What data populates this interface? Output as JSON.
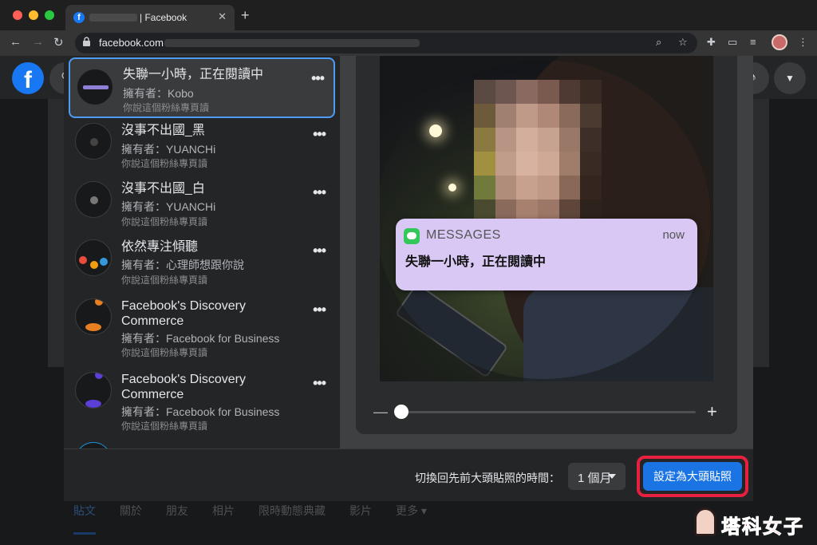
{
  "browser": {
    "tab_title": "| Facebook",
    "url": "facebook.com",
    "tab_close": "✕",
    "new_tab": "+"
  },
  "facebook": {
    "bottom_tabs": [
      "貼文",
      "關於",
      "朋友",
      "相片",
      "限時動態典藏",
      "影片",
      "更多 ▾"
    ]
  },
  "sidebar": {
    "items": [
      {
        "name": "失聯一小時，正在閱讀中",
        "owner": "擁有者：Kobo",
        "subtitle": "你說這個粉絲專頁讀",
        "selected": true
      },
      {
        "name": "沒事不出國_黑",
        "owner": "擁有者：YUANCHi",
        "subtitle": "你說這個粉絲專頁讀"
      },
      {
        "name": "沒事不出國_白",
        "owner": "擁有者：YUANCHi",
        "subtitle": "你說這個粉絲專頁讀"
      },
      {
        "name": "依然專注傾聽",
        "owner": "擁有者：心理師想跟你說",
        "subtitle": "你說這個粉絲專頁讀"
      },
      {
        "name": "Facebook's Discovery Commerce",
        "owner": "擁有者：Facebook for Business",
        "subtitle": "你說這個粉絲專頁讀"
      },
      {
        "name": "Facebook's Discovery Commerce",
        "owner": "擁有者：Facebook for Business",
        "subtitle": "你說這個粉絲專頁讀"
      }
    ],
    "more_glyph": "•••"
  },
  "notification": {
    "app": "MESSAGES",
    "time": "now",
    "message": "失聯一小時，正在閱讀中"
  },
  "zoom": {
    "minus": "—",
    "plus": "+",
    "level": 0.0
  },
  "footer": {
    "label": "切換回先前大頭貼照的時間：",
    "duration": "1 個月",
    "set_button": "設定為大頭貼照"
  },
  "watermark": "塔科女子",
  "colors": {
    "accent": "#1b74e4",
    "highlight": "#e8203f",
    "selected_border": "#4c9cf6"
  }
}
